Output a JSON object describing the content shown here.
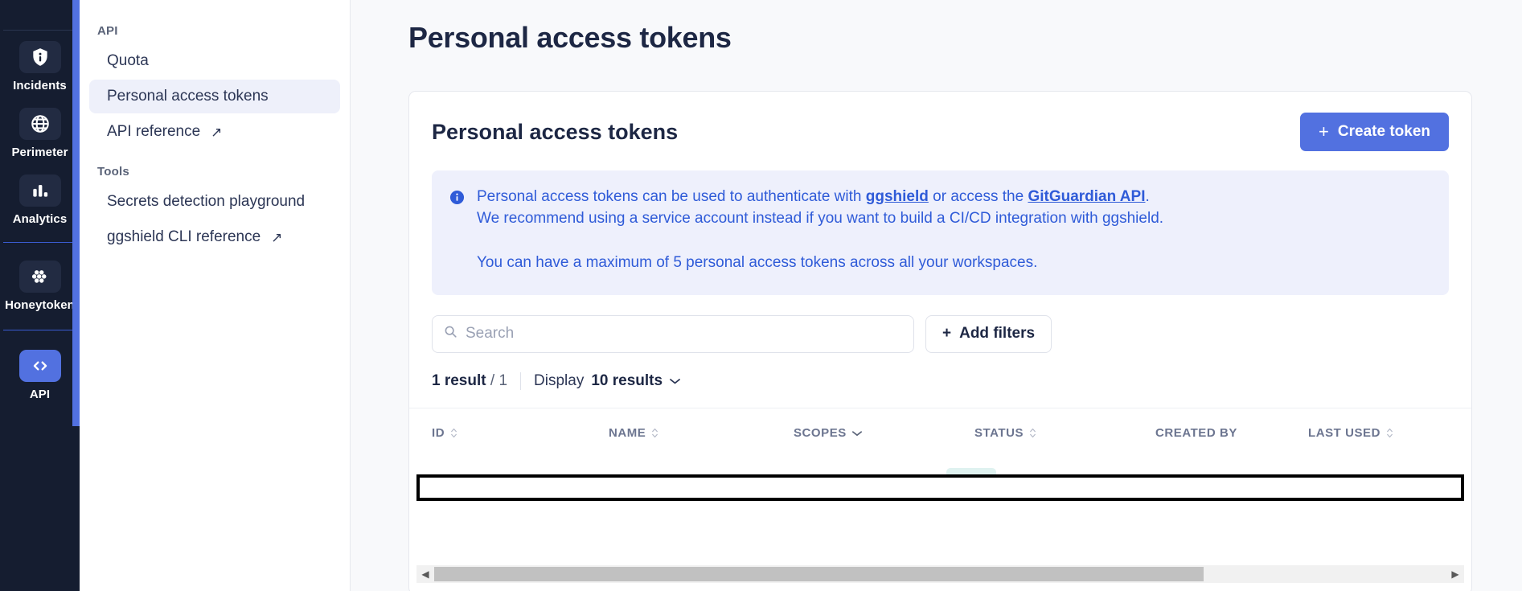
{
  "rail": {
    "items": [
      {
        "label": "Incidents",
        "icon": "shield-info-icon",
        "active": false
      },
      {
        "label": "Perimeter",
        "icon": "globe-icon",
        "active": false
      },
      {
        "label": "Analytics",
        "icon": "bar-chart-icon",
        "active": false
      },
      {
        "label": "Honeytoken",
        "icon": "honeycomb-icon",
        "active": false
      },
      {
        "label": "API",
        "icon": "code-brackets-icon",
        "active": true
      }
    ],
    "accent_color": "#5271e0",
    "background_color": "#151d30"
  },
  "subnav": {
    "sections": [
      {
        "title": "API",
        "items": [
          {
            "label": "Quota",
            "active": false,
            "external": false
          },
          {
            "label": "Personal access tokens",
            "active": true,
            "external": false
          },
          {
            "label": "API reference",
            "active": false,
            "external": true
          }
        ]
      },
      {
        "title": "Tools",
        "items": [
          {
            "label": "Secrets detection playground",
            "active": false,
            "external": false
          },
          {
            "label": "ggshield CLI reference",
            "active": false,
            "external": true
          }
        ]
      }
    ],
    "external_icon": "↗"
  },
  "page": {
    "title": "Personal access tokens"
  },
  "card": {
    "title": "Personal access tokens",
    "create_button": {
      "label": "Create token",
      "plus": "+",
      "color": "#5271e0"
    }
  },
  "banner": {
    "icon": "info-icon",
    "accent_color": "#2f5bd8",
    "background_color": "#eef0fc",
    "line1_prefix": "Personal access tokens can be used to authenticate with ",
    "line1_link1": "ggshield",
    "line1_middle": " or access the ",
    "line1_link2": "GitGuardian API",
    "line1_suffix": ".",
    "line2": "We recommend using a service account instead if you want to build a CI/CD integration with ggshield.",
    "line3": "You can have a maximum of 5 personal access tokens across all your workspaces."
  },
  "search": {
    "placeholder": "Search",
    "value": "",
    "icon": "search-icon",
    "add_filters_label": "Add filters",
    "add_filters_plus": "+"
  },
  "results": {
    "count_text": "1 result",
    "separator": "/",
    "pages": "1",
    "display_label": "Display",
    "display_value": "10 results",
    "chevron": "⌄"
  },
  "table": {
    "columns": [
      {
        "label": "ID",
        "sortable": true,
        "dropdown": false
      },
      {
        "label": "NAME",
        "sortable": true,
        "dropdown": false
      },
      {
        "label": "SCOPES",
        "sortable": false,
        "dropdown": true
      },
      {
        "label": "STATUS",
        "sortable": true,
        "dropdown": false
      },
      {
        "label": "CREATED BY",
        "sortable": false,
        "dropdown": false
      },
      {
        "label": "LAST USED",
        "sortable": true,
        "dropdown": false
      }
    ],
    "rows": [
      {
        "focused": true,
        "cells": [
          "",
          "",
          "",
          "",
          "",
          ""
        ]
      }
    ]
  },
  "scrollbar": {
    "left_arrow": "◀",
    "right_arrow": "▶"
  }
}
